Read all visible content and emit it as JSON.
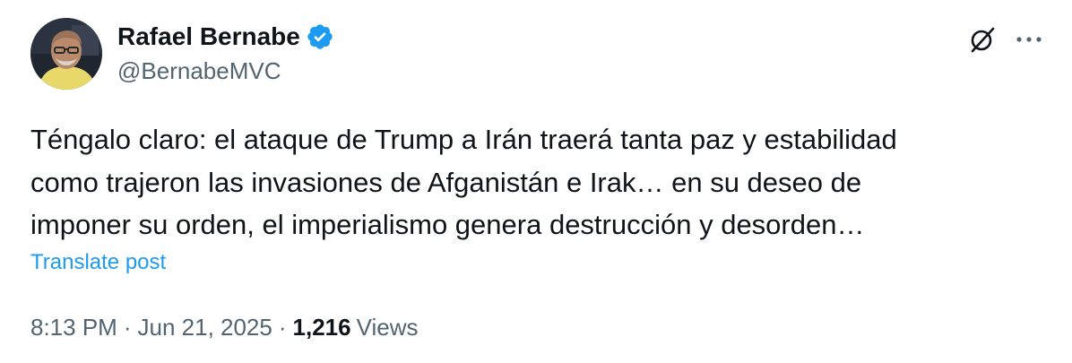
{
  "author": {
    "display_name": "Rafael Bernabe",
    "handle": "@BernabeMVC",
    "verified": true,
    "verified_color": "#1d9bf0"
  },
  "header": {
    "grok_icon": "slashed-circle-icon",
    "more_icon": "more-horizontal-icon"
  },
  "tweet": {
    "text_lines": [
      "Téngalo claro: el ataque de Trump a Irán traerá tanta paz y estabilidad",
      "como trajeron las invasiones de Afganistán e Irak… en su deseo de",
      "imponer su orden, el imperialismo genera destrucción y desorden…"
    ]
  },
  "translate_label": "Translate post",
  "meta": {
    "time": "8:13 PM",
    "separator": "·",
    "date": "Jun 21, 2025",
    "views_count": "1,216",
    "views_label": "Views"
  },
  "colors": {
    "text_primary": "#0f1419",
    "text_secondary": "#536471",
    "link": "#1d9bf0"
  }
}
